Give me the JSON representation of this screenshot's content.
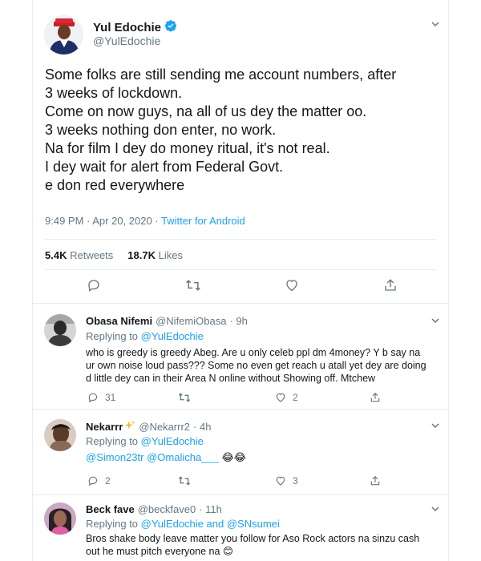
{
  "main_tweet": {
    "display_name": "Yul Edochie",
    "handle": "@YulEdochie",
    "verified": true,
    "text_lines": [
      "Some folks are still sending me account numbers, after",
      "3 weeks of lockdown.",
      "Come on now guys, na all of us dey the matter oo.",
      "3 weeks nothing don enter, no work.",
      "Na for film I dey do money ritual, it's not real.",
      "I dey wait for alert from Federal Govt.",
      "e don red everywhere"
    ],
    "timestamp": "9:49 PM · Apr 20, 2020 · ",
    "source": "Twitter for Android",
    "retweets_count": "5.4K",
    "retweets_label": "Retweets",
    "likes_count": "18.7K",
    "likes_label": "Likes"
  },
  "replies": [
    {
      "display_name": "Obasa Nifemi",
      "handle": "@NifemiObasa",
      "time": "· 9h",
      "replying_prefix": "Replying to ",
      "replying_to": [
        "@YulEdochie"
      ],
      "text_lines": [
        "who is greedy is greedy Abeg. Are u only celeb ppl dm 4money? Y b say na",
        "ur own noise loud pass??? Some no even get reach u atall yet dey are doing",
        "d little dey can in their Area N online without Showing off. Mtchew"
      ],
      "reply_count": "31",
      "retweet_count": "",
      "like_count": "2"
    },
    {
      "display_name": "Nekarrr",
      "handle": "@Nekarrr2",
      "time": "· 4h",
      "replying_prefix": "Replying to ",
      "replying_to": [
        "@YulEdochie"
      ],
      "mentions": [
        "@Simon23tr",
        "@Omalicha___"
      ],
      "emojis": "😂😂",
      "reply_count": "2",
      "retweet_count": "",
      "like_count": "3"
    },
    {
      "display_name": "Beck fave",
      "handle": "@beckfave0",
      "time": "· 11h",
      "replying_prefix": "Replying to ",
      "replying_to": [
        "@YulEdochie",
        "@SNsumei"
      ],
      "replying_joiner": " and ",
      "text_lines": [
        "Bros shake body leave matter you follow for  Aso Rock actors na sinzu cash",
        "out he must pitch everyone na 😊"
      ]
    }
  ],
  "icons": {
    "verified": "verified-badge-icon",
    "caret": "chevron-down-icon",
    "reply": "reply-icon",
    "retweet": "retweet-icon",
    "like": "heart-icon",
    "share": "share-icon",
    "sparkle": "sparkles-icon"
  },
  "colors": {
    "brand_blue": "#1da1f2",
    "text_primary": "#14171a",
    "text_secondary": "#657786",
    "border": "#e6ecf0"
  }
}
